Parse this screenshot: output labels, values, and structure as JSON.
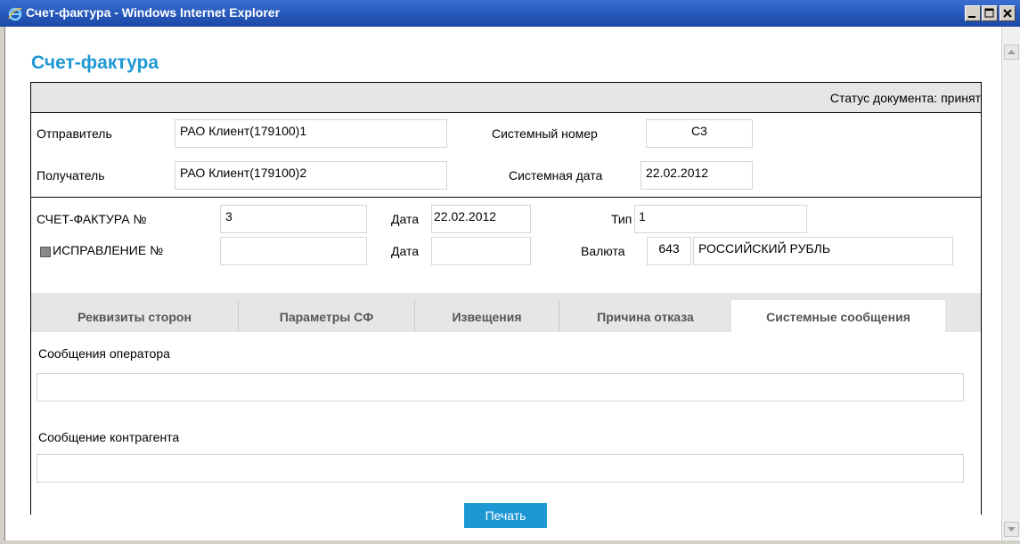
{
  "window": {
    "title": "Счет-фактура - Windows Internet Explorer"
  },
  "page": {
    "title": "Счет-фактура",
    "status": "Статус документа: принят"
  },
  "header": {
    "sender_label": "Отправитель",
    "sender_value": "РАО Клиент(179100)1",
    "recipient_label": "Получатель",
    "recipient_value": "РАО Клиент(179100)2",
    "sysnum_label": "Системный номер",
    "sysnum_value": "С3",
    "sysdate_label": "Системная дата",
    "sysdate_value": "22.02.2012"
  },
  "invoice": {
    "number_label": "СЧЕТ-ФАКТУРА №",
    "number_value": "3",
    "date_label": "Дата",
    "date_value": "22.02.2012",
    "type_label": "Тип",
    "type_value": "1",
    "correction_label": "ИСПРАВЛЕНИЕ №",
    "correction_value": "",
    "correction_date_label": "Дата",
    "correction_date_value": "",
    "currency_label": "Валюта",
    "currency_code": "643",
    "currency_name": "РОССИЙСКИЙ РУБЛЬ"
  },
  "tabs": [
    {
      "label": "Реквизиты сторон"
    },
    {
      "label": "Параметры СФ"
    },
    {
      "label": "Извещения"
    },
    {
      "label": "Причина отказа"
    },
    {
      "label": "Системные сообщения"
    }
  ],
  "messages": {
    "operator_label": "Сообщения оператора",
    "operator_value": "",
    "counterparty_label": "Сообщение контрагента",
    "counterparty_value": ""
  },
  "actions": {
    "print_label": "Печать"
  },
  "colors": {
    "accent": "#1e98d4",
    "titlebar": "#2456b8"
  }
}
